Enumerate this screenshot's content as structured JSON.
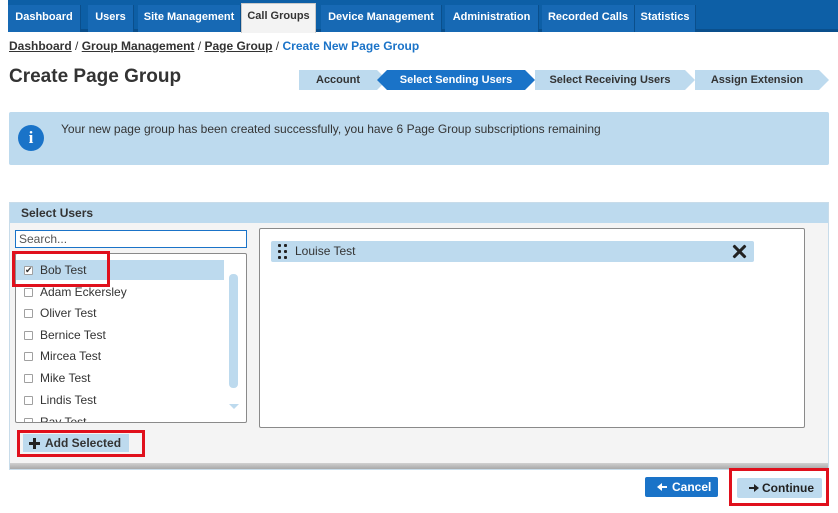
{
  "nav": {
    "tabs": [
      {
        "label": "Dashboard"
      },
      {
        "label": "Users"
      },
      {
        "label": "Site Management"
      },
      {
        "label": "Call Groups"
      },
      {
        "label": "Device Management"
      },
      {
        "label": "Administration"
      },
      {
        "label": "Recorded Calls"
      },
      {
        "label": "Statistics"
      }
    ],
    "active_tab": "Call Groups"
  },
  "breadcrumb": {
    "items": [
      "Dashboard",
      "Group Management",
      "Page Group"
    ],
    "current": "Create New Page Group",
    "separator": "/"
  },
  "page": {
    "title": "Create Page Group"
  },
  "wizard": {
    "steps": [
      {
        "label": "Account"
      },
      {
        "label": "Select Sending Users"
      },
      {
        "label": "Select Receiving Users"
      },
      {
        "label": "Assign Extension"
      }
    ],
    "active_step": "Select Sending Users"
  },
  "info": {
    "icon": "info-icon",
    "message": "Your new page group has been created successfully, you have 6 Page Group subscriptions remaining"
  },
  "select_users": {
    "heading": "Select Users",
    "search_placeholder": "Search...",
    "users": [
      {
        "label": "Bob Test",
        "checked": true
      },
      {
        "label": "Adam Eckersley",
        "checked": false
      },
      {
        "label": "Oliver Test",
        "checked": false
      },
      {
        "label": "Bernice Test",
        "checked": false
      },
      {
        "label": "Mircea Test",
        "checked": false
      },
      {
        "label": "Mike Test",
        "checked": false
      },
      {
        "label": "Lindis Test",
        "checked": false
      },
      {
        "label": "Ray Test",
        "checked": false
      }
    ],
    "add_selected_label": "Add Selected",
    "selected_users": [
      {
        "label": "Louise Test"
      }
    ]
  },
  "actions": {
    "cancel_label": "Cancel",
    "continue_label": "Continue"
  },
  "colors": {
    "nav_blue": "#0d5fa6",
    "accent_blue": "#1a73c8",
    "light_blue": "#bddaee",
    "highlight_red": "#e0101c"
  }
}
